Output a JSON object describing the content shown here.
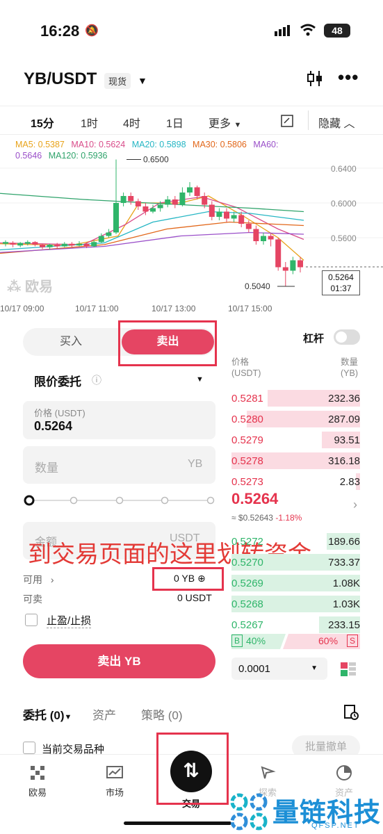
{
  "status": {
    "time": "16:28",
    "battery": "48"
  },
  "header": {
    "pair": "YB/USDT",
    "market_type": "现货"
  },
  "timeframes": [
    "15分",
    "1时",
    "4时",
    "1日",
    "更多"
  ],
  "hide_label": "隐藏",
  "chart_data": {
    "type": "candlestick",
    "ma_labels": [
      "MA5: 0.5387",
      "MA10: 0.5624",
      "MA20: 0.5898",
      "MA30: 0.5806",
      "MA60: 0.5646",
      "MA120: 0.5936"
    ],
    "y_ticks": [
      "0.6400",
      "0.6000",
      "0.5600"
    ],
    "x_ticks": [
      "10/17 09:00",
      "10/17 11:00",
      "10/17 13:00",
      "10/17 15:00"
    ],
    "high_label": "0.6500",
    "low_label": "0.5040",
    "current_price": "0.5264",
    "countdown": "01:37",
    "watermark": "欧易"
  },
  "trade": {
    "buy_tab": "买入",
    "sell_tab": "卖出",
    "order_type": "限价委托",
    "price_label": "价格 (USDT)",
    "price_value": "0.5264",
    "qty_placeholder": "数量",
    "qty_unit": "YB",
    "total_placeholder": "金额",
    "total_unit": "USDT",
    "available_label": "可用",
    "available_value": "0 YB",
    "sellable_label": "可卖",
    "sellable_value": "0 USDT",
    "tpsl_label": "止盈/止损",
    "sell_button": "卖出 YB",
    "overlay_text": "到交易页面的这里划转资金"
  },
  "orderbook": {
    "leverage_label": "杠杆",
    "price_header": [
      "价格",
      "(USDT)"
    ],
    "qty_header": [
      "数量",
      "(YB)"
    ],
    "asks": [
      {
        "price": "0.5281",
        "qty": "232.36",
        "depth": 0.72
      },
      {
        "price": "0.5280",
        "qty": "287.09",
        "depth": 0.88
      },
      {
        "price": "0.5279",
        "qty": "93.51",
        "depth": 0.3
      },
      {
        "price": "0.5278",
        "qty": "316.18",
        "depth": 1.0
      },
      {
        "price": "0.5273",
        "qty": "2.83",
        "depth": 0.03
      }
    ],
    "mid_price": "0.5264",
    "mid_usd": "≈ $0.52643",
    "mid_change": "-1.18%",
    "bids": [
      {
        "price": "0.5272",
        "qty": "189.66",
        "depth": 0.26
      },
      {
        "price": "0.5270",
        "qty": "733.37",
        "depth": 1.0
      },
      {
        "price": "0.5269",
        "qty": "1.08K",
        "depth": 1.0
      },
      {
        "price": "0.5268",
        "qty": "1.03K",
        "depth": 1.0
      },
      {
        "price": "0.5267",
        "qty": "233.15",
        "depth": 0.32
      }
    ],
    "buy_ratio": "40%",
    "sell_ratio": "60%",
    "buy_ratio_value": 0.4,
    "depth_select": "0.0001"
  },
  "orders": {
    "entrust": "委托 (0)",
    "assets": "资产",
    "strategy": "策略 (0)",
    "current_pair": "当前交易品种",
    "batch_cancel": "批量撤单"
  },
  "nav": [
    {
      "label": "欧易"
    },
    {
      "label": "市场"
    },
    {
      "label": "交易"
    },
    {
      "label": "探索"
    },
    {
      "label": "资产"
    }
  ],
  "brand": {
    "name": "量链科技",
    "domain": "QFSP.NET"
  },
  "colors": {
    "red": "#e54563",
    "green": "#2fb56a",
    "overlay_red": "#e33a36"
  }
}
